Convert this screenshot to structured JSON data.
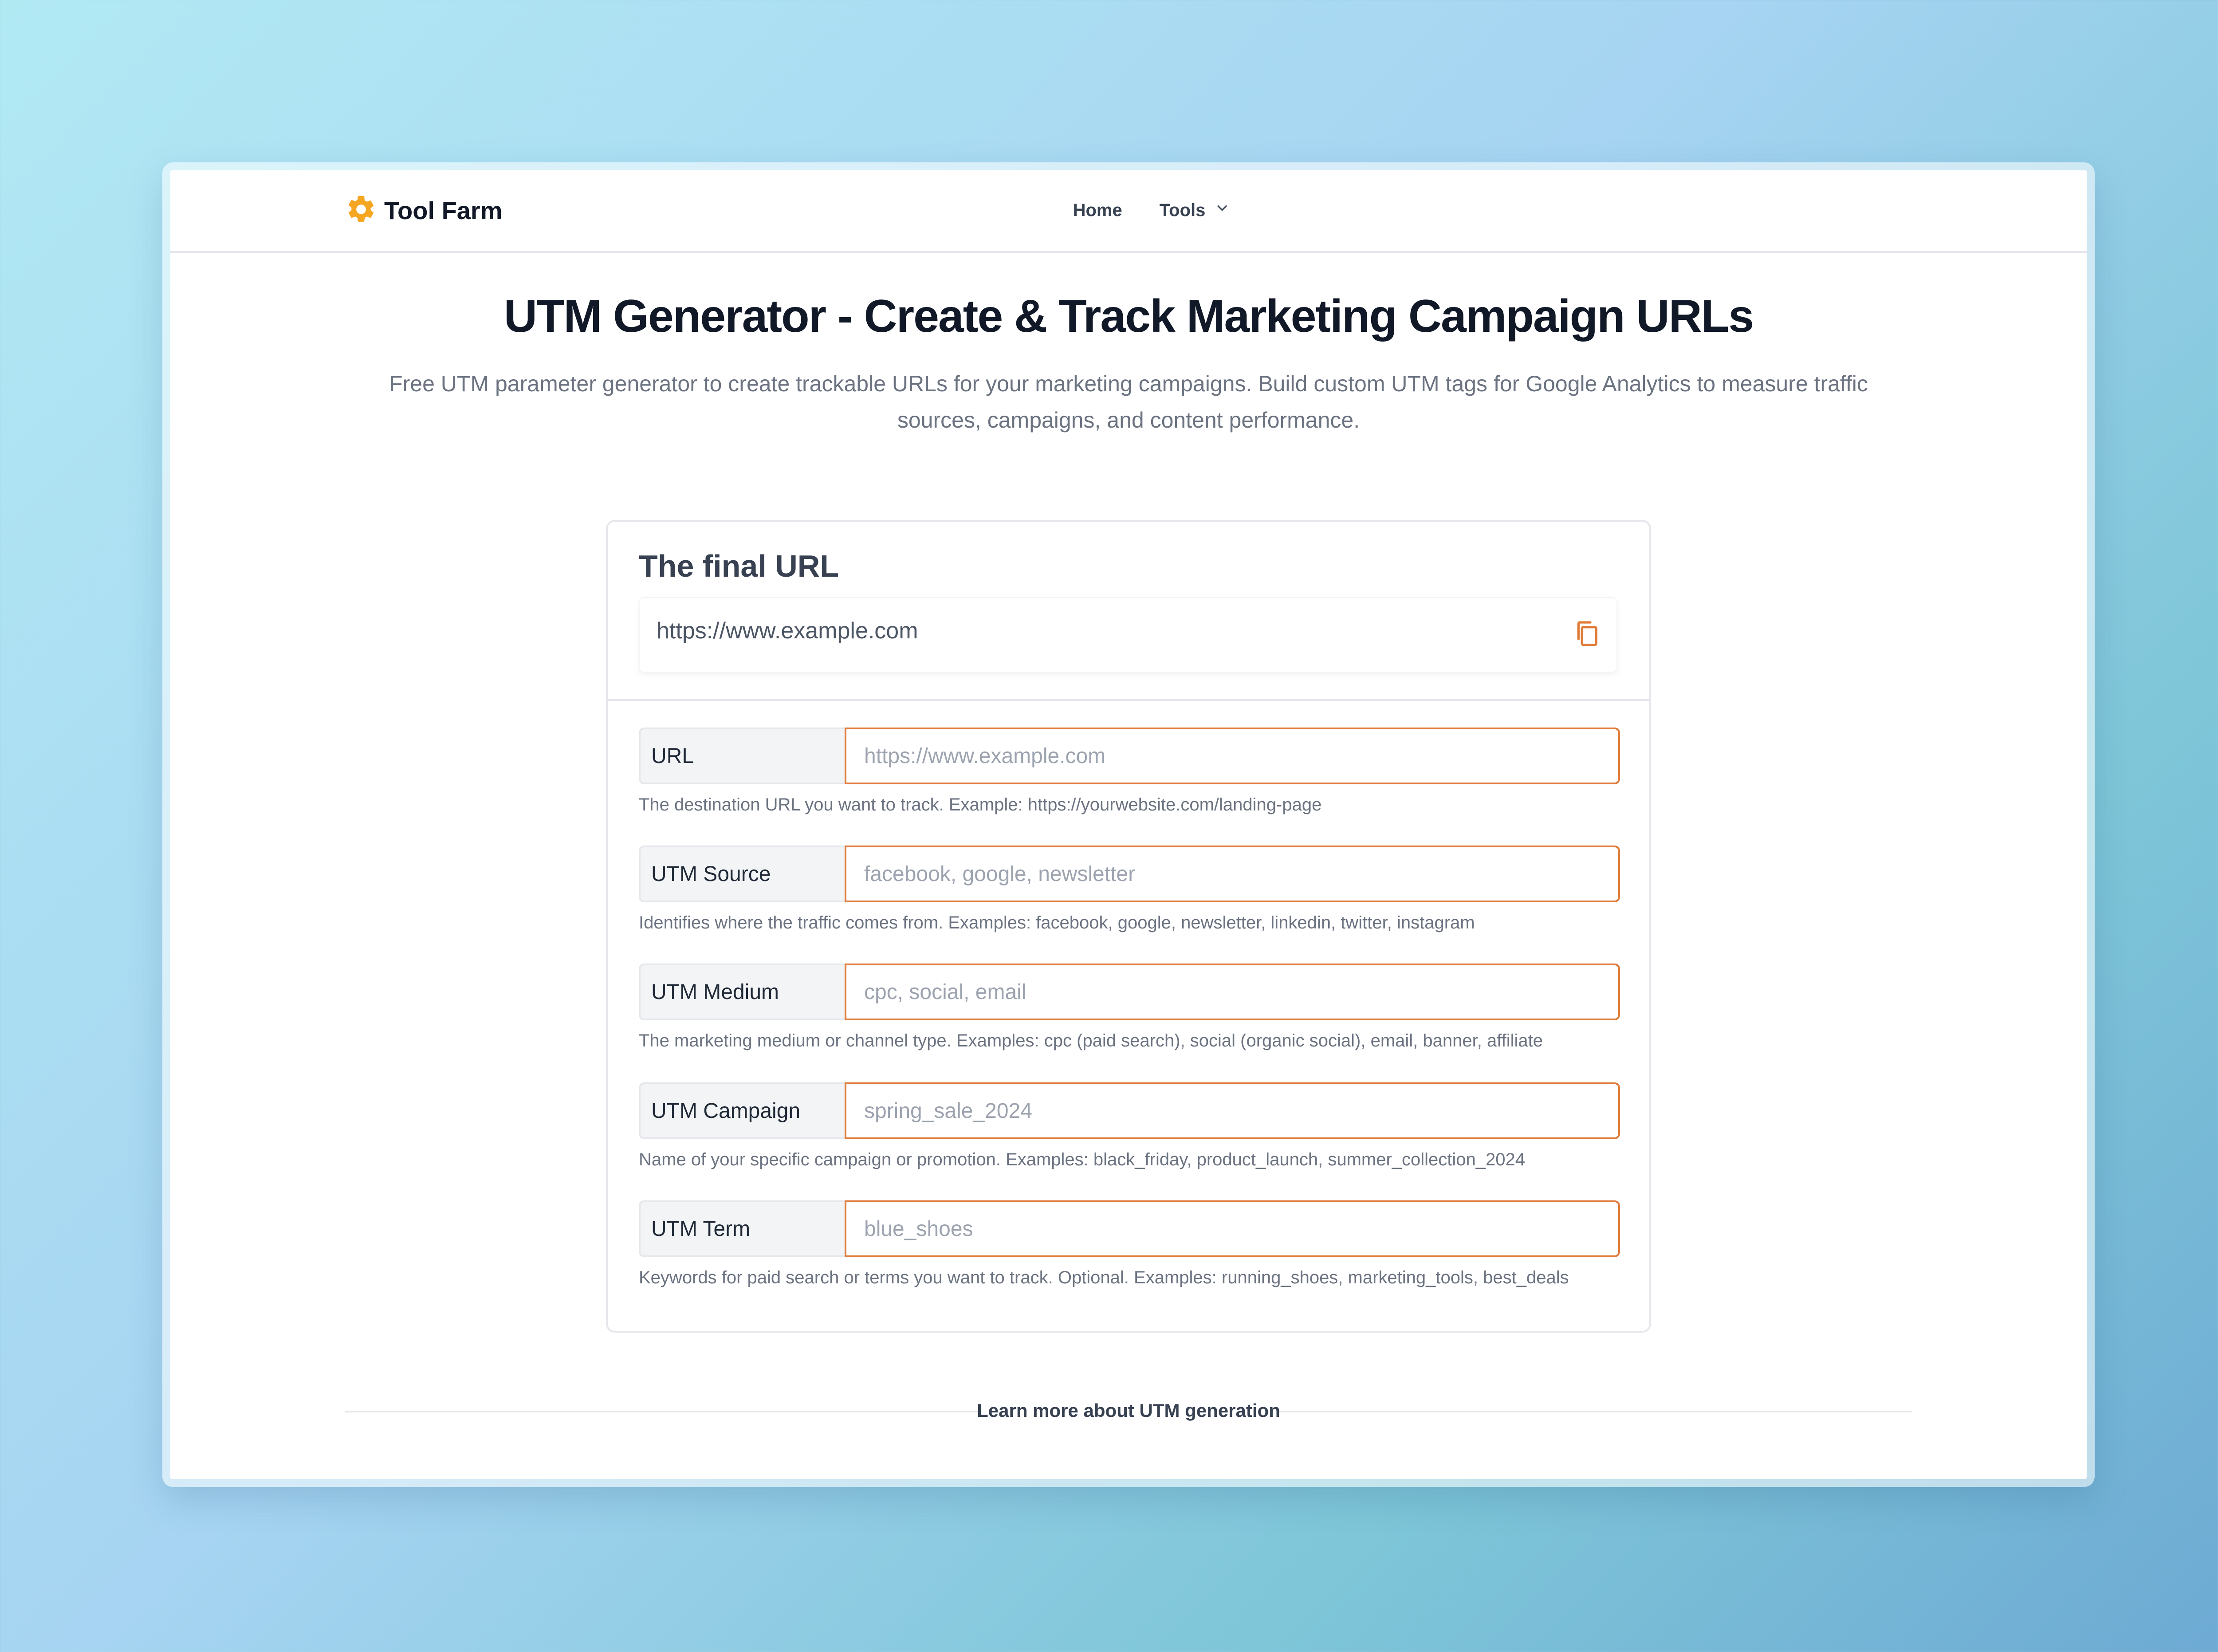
{
  "header": {
    "brand_name": "Tool Farm",
    "brand_icon": "gear-icon",
    "brand_color": "#f5a623",
    "nav": {
      "home_label": "Home",
      "tools_label": "Tools"
    }
  },
  "hero": {
    "title": "UTM Generator - Create & Track Marketing Campaign URLs",
    "description": "Free UTM parameter generator to create trackable URLs for your marketing campaigns. Build custom UTM tags for Google Analytics to measure traffic sources, campaigns, and content performance."
  },
  "card": {
    "final_title": "The final URL",
    "final_url": "https://www.example.com",
    "copy_icon": "copy-icon",
    "accent_color": "#e07b39",
    "fields": [
      {
        "label": "URL",
        "value": "",
        "placeholder": "https://www.example.com",
        "help": "The destination URL you want to track. Example: https://yourwebsite.com/landing-page"
      },
      {
        "label": "UTM Source",
        "value": "",
        "placeholder": "facebook, google, newsletter",
        "help": "Identifies where the traffic comes from. Examples: facebook, google, newsletter, linkedin, twitter, instagram"
      },
      {
        "label": "UTM Medium",
        "value": "",
        "placeholder": "cpc, social, email",
        "help": "The marketing medium or channel type. Examples: cpc (paid search), social (organic social), email, banner, affiliate"
      },
      {
        "label": "UTM Campaign",
        "value": "",
        "placeholder": "spring_sale_2024",
        "help": "Name of your specific campaign or promotion. Examples: black_friday, product_launch, summer_collection_2024"
      },
      {
        "label": "UTM Term",
        "value": "",
        "placeholder": "blue_shoes",
        "help": "Keywords for paid search or terms you want to track. Optional. Examples: running_shoes, marketing_tools, best_deals"
      }
    ]
  },
  "learn_more": {
    "label": "Learn more about UTM generation"
  }
}
